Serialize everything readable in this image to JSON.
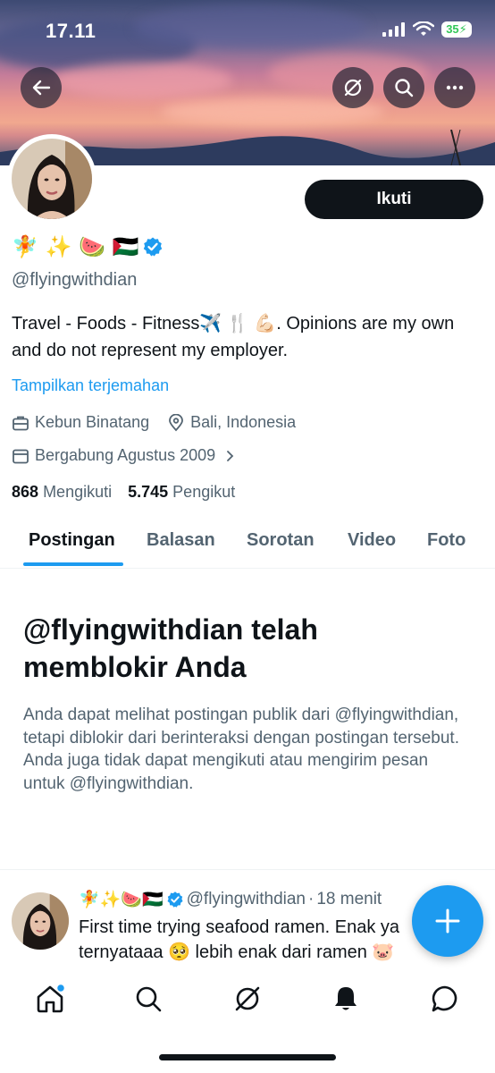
{
  "status_bar": {
    "time": "17.11",
    "battery": "35"
  },
  "header": {
    "back_icon": "arrow-left-icon",
    "grok_icon": "grok-icon",
    "search_icon": "search-icon",
    "more_icon": "more-icon"
  },
  "profile": {
    "display_name_emojis": "🧚 ✨ 🍉 🇵🇸",
    "handle": "@flyingwithdian",
    "follow_label": "Ikuti",
    "bio": "Travel - Foods - Fitness✈️ 🍴 💪🏻. Opinions are my own and do not represent my employer.",
    "translate_link": "Tampilkan terjemahan",
    "category": "Kebun Binatang",
    "location": "Bali, Indonesia",
    "joined": "Bergabung Agustus 2009",
    "following_count": "868",
    "following_label": "Mengikuti",
    "followers_count": "5.745",
    "followers_label": "Pengikut"
  },
  "tabs": [
    {
      "label": "Postingan",
      "active": true
    },
    {
      "label": "Balasan",
      "active": false
    },
    {
      "label": "Sorotan",
      "active": false
    },
    {
      "label": "Video",
      "active": false
    },
    {
      "label": "Foto",
      "active": false
    }
  ],
  "blocked": {
    "title": "@flyingwithdian telah memblokir Anda",
    "description": "Anda dapat melihat postingan publik dari @flyingwithdian, tetapi diblokir dari berinteraksi dengan postingan tersebut. Anda juga tidak dapat mengikuti atau mengirim pesan untuk @flyingwithdian."
  },
  "tweet": {
    "name_emojis": "🧚✨🍉🇵🇸",
    "handle": "@flyingwithdian",
    "separator": "·",
    "time": "18 menit",
    "line1": "First time trying seafood ramen. Enak ya",
    "line2": "ternyataaa 🥺 lebih enak dari ramen 🐷"
  },
  "colors": {
    "accent": "#1d9bf0",
    "text_primary": "#0f1419",
    "text_secondary": "#536471",
    "follow_bg": "#0f1419"
  },
  "bottom_nav": [
    "home-icon",
    "search-icon",
    "grok-icon",
    "notifications-icon",
    "messages-icon"
  ]
}
